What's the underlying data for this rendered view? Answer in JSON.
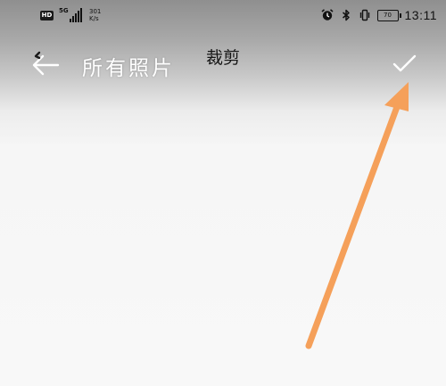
{
  "status_bar": {
    "hd_badge": "HD",
    "network_type": "5G",
    "net_speed_value": "301",
    "net_speed_unit": "K/s",
    "battery_level": "70",
    "time": "13:11"
  },
  "toolbar": {
    "album_title": "所有照片",
    "screen_title": "裁剪"
  },
  "icons": {
    "back": "back-arrow-icon",
    "confirm": "check-icon",
    "alarm": "alarm-icon",
    "bluetooth": "bluetooth-icon",
    "vibrate": "vibrate-icon",
    "annotation": "orange-arrow-annotation"
  },
  "colors": {
    "annotation_arrow": "#f5a05a",
    "toolbar_text": "#ffffff",
    "title_text": "#151515"
  }
}
